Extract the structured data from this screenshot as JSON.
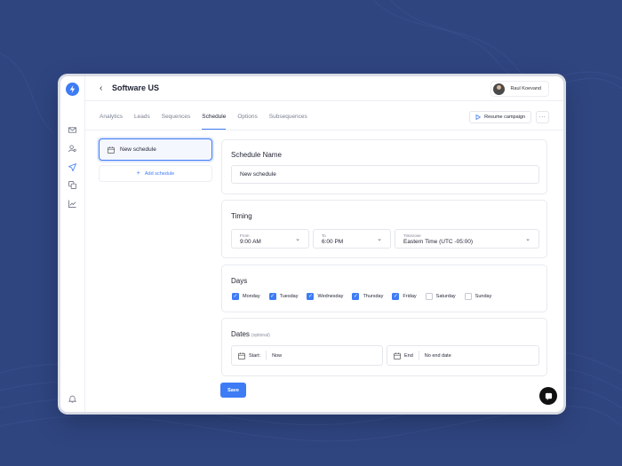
{
  "colors": {
    "accent": "#3e7cf6",
    "background": "#2f4580"
  },
  "header": {
    "back_icon": "chevron-left-icon",
    "title": "Software US",
    "user_name": "Raul Koevand"
  },
  "rail": {
    "icons": [
      "mail-icon",
      "contacts-icon",
      "send-icon",
      "copy-icon",
      "chart-icon",
      "bell-icon"
    ]
  },
  "tabs": [
    {
      "label": "Analytics",
      "active": false
    },
    {
      "label": "Leads",
      "active": false
    },
    {
      "label": "Sequences",
      "active": false
    },
    {
      "label": "Schedule",
      "active": true
    },
    {
      "label": "Options",
      "active": false
    },
    {
      "label": "Subsequences",
      "active": false
    }
  ],
  "actions": {
    "resume_label": "Resume campaign",
    "more_label": "···"
  },
  "schedules": {
    "items": [
      {
        "label": "New schedule"
      }
    ],
    "add_label": "Add schedule"
  },
  "schedule_name": {
    "title": "Schedule Name",
    "value": "New schedule"
  },
  "timing": {
    "title": "Timing",
    "from_caption": "From",
    "from_value": "9:00 AM",
    "to_caption": "To",
    "to_value": "6:00 PM",
    "timezone_caption": "Timezone",
    "timezone_value": "Eastern Time (UTC -05:00)"
  },
  "days": {
    "title": "Days",
    "items": [
      {
        "label": "Monday",
        "checked": true
      },
      {
        "label": "Tuesday",
        "checked": true
      },
      {
        "label": "Wednesday",
        "checked": true
      },
      {
        "label": "Thursday",
        "checked": true
      },
      {
        "label": "Friday",
        "checked": true
      },
      {
        "label": "Saturday",
        "checked": false
      },
      {
        "label": "Sunday",
        "checked": false
      }
    ]
  },
  "dates": {
    "title": "Dates",
    "optional_label": "(optional)",
    "start_label": "Start:",
    "start_value": "Now",
    "end_label": "End",
    "end_value": "No end date"
  },
  "footer": {
    "save_label": "Save"
  }
}
